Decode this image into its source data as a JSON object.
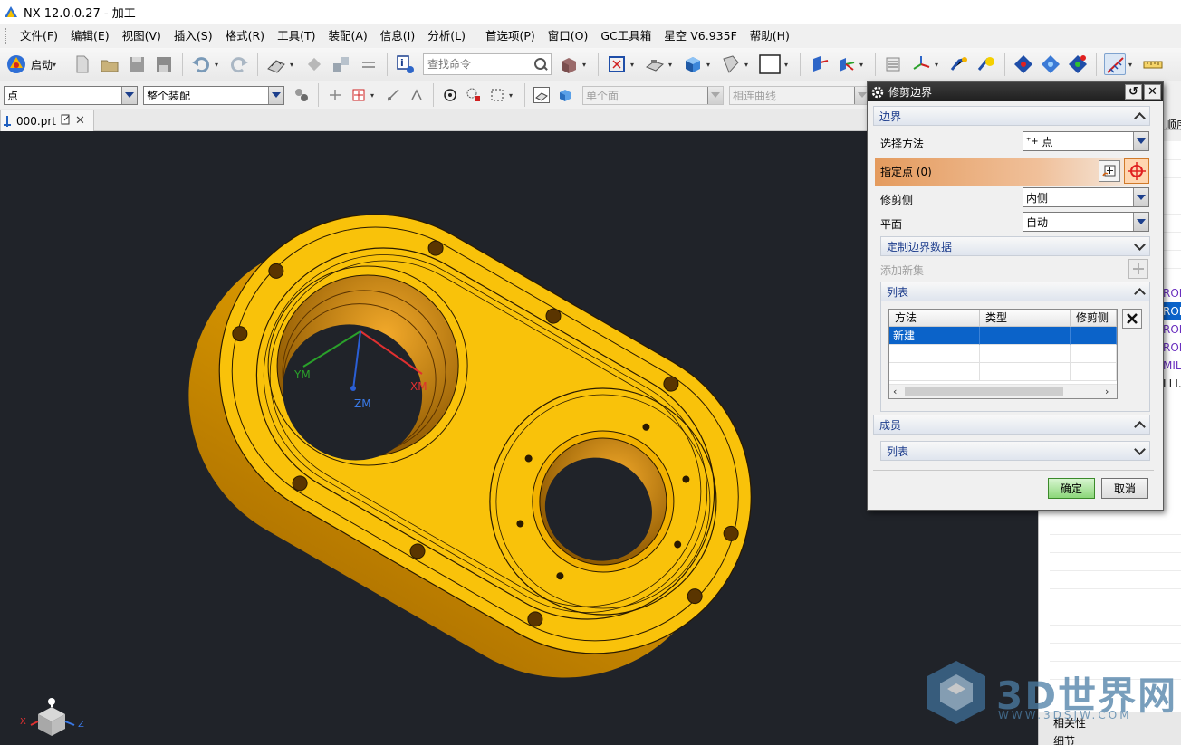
{
  "window": {
    "title": "NX 12.0.0.27 - 加工"
  },
  "menu": [
    "文件(F)",
    "编辑(E)",
    "视图(V)",
    "插入(S)",
    "格式(R)",
    "工具(T)",
    "装配(A)",
    "信息(I)",
    "分析(L)",
    "首选项(P)",
    "窗口(O)",
    "GC工具箱",
    "星空 V6.935F",
    "帮助(H)"
  ],
  "toolbar1": {
    "start_label": "启动",
    "search_placeholder": "查找命令"
  },
  "toolbar2": {
    "select_filter": "点",
    "assembly_scope": "整个装配",
    "face_rule": "单个面",
    "curve_rule": "相连曲线"
  },
  "file_tab": {
    "label": "000.prt"
  },
  "viewport": {
    "axis_labels": {
      "ym": "YM",
      "xm": "XM",
      "zm": "ZM"
    },
    "triad_labels": {
      "x": "X",
      "z": "Z"
    }
  },
  "navigator": {
    "header": "顺序",
    "rows": [
      "ROI",
      "ROI",
      "ROI",
      "ROI",
      "MIL",
      "LLI."
    ],
    "bottom": [
      "相关性",
      "细节"
    ]
  },
  "dialog": {
    "title": "修剪边界",
    "group_boundary": "边界",
    "select_method_label": "选择方法",
    "select_method_value": "点",
    "specify_point_label": "指定点 (0)",
    "trim_side_label": "修剪侧",
    "trim_side_value": "内侧",
    "plane_label": "平面",
    "plane_value": "自动",
    "custom_boundary_data": "定制边界数据",
    "add_new_set": "添加新集",
    "list_group": "列表",
    "list_columns": [
      "方法",
      "类型",
      "修剪侧"
    ],
    "list_rows": [
      [
        "新建",
        "",
        ""
      ]
    ],
    "members_group": "成员",
    "members_list": "列表",
    "ok": "确定",
    "cancel": "取消"
  },
  "watermark": {
    "big": "3D世界网",
    "small": "WWW.3DSJW.COM"
  },
  "colors": {
    "part": "#f9c20a",
    "viewport_bg": "#202329",
    "selection": "#0b63c9",
    "accent_orange": "#e49b5e"
  }
}
